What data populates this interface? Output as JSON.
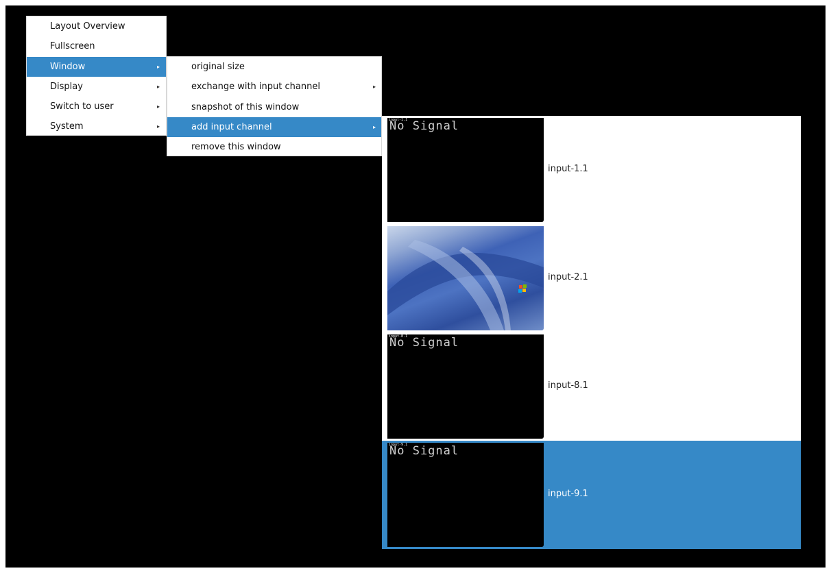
{
  "main_menu": {
    "items": [
      {
        "label": "Layout Overview",
        "submenu": false
      },
      {
        "label": "Fullscreen",
        "submenu": false
      },
      {
        "label": "Window",
        "submenu": true,
        "selected": true
      },
      {
        "label": "Display",
        "submenu": true
      },
      {
        "label": "Switch to user",
        "submenu": true
      },
      {
        "label": "System",
        "submenu": true
      }
    ],
    "arrow_glyph": "▸"
  },
  "window_menu": {
    "items": [
      {
        "label": "original size",
        "submenu": false
      },
      {
        "label": "exchange with input channel",
        "submenu": true
      },
      {
        "label": "snapshot of this window",
        "submenu": false
      },
      {
        "label": "add input channel",
        "submenu": true,
        "selected": true
      },
      {
        "label": "remove this window",
        "submenu": false
      }
    ]
  },
  "channels": [
    {
      "label": "input-1.1",
      "thumb_text": "No Signal",
      "tag": "input-1.1",
      "selected": false
    },
    {
      "label": "input-2.1",
      "thumb_text": "",
      "tag": "",
      "selected": false,
      "thumb_icon": "windows-xp-wallpaper"
    },
    {
      "label": "input-8.1",
      "thumb_text": "No Signal",
      "tag": "input-8.1",
      "selected": false
    },
    {
      "label": "input-9.1",
      "thumb_text": "No Signal",
      "tag": "input-9.1",
      "selected": true
    }
  ],
  "colors": {
    "selection": "#3689c7",
    "background": "#000000",
    "menu_bg": "#ffffff"
  }
}
